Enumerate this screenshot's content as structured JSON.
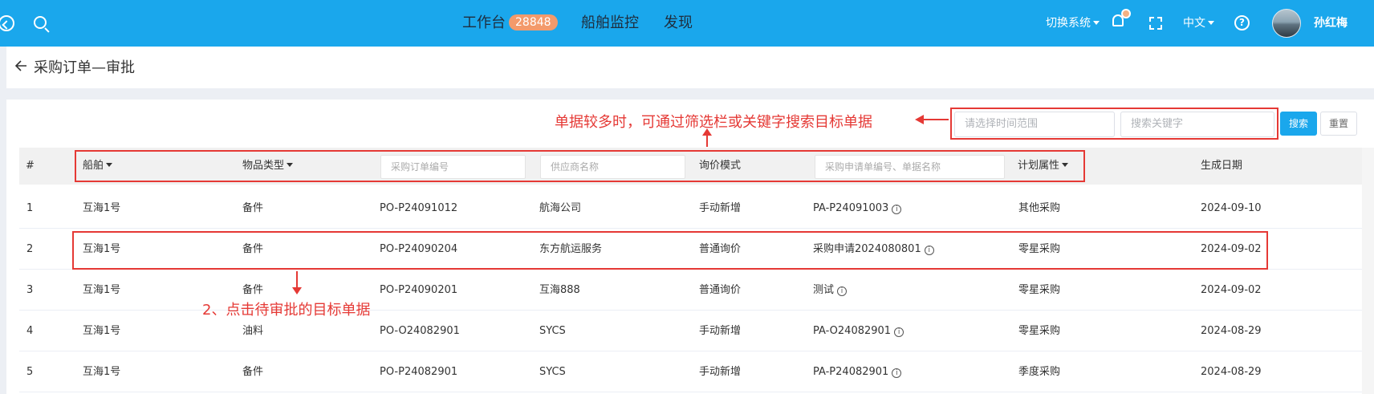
{
  "topbar": {
    "nav": [
      {
        "label": "工作台",
        "badge": "28848"
      },
      {
        "label": "船舶监控"
      },
      {
        "label": "发现"
      }
    ],
    "switch_system": "切换系统",
    "language": "中文",
    "user_name": "孙红梅",
    "colors": {
      "bar": "#1aa7ec",
      "badge": "#f39a6b"
    }
  },
  "page": {
    "title": "采购订单—审批"
  },
  "filters": {
    "time_range_placeholder": "请选择时间范围",
    "keyword_placeholder": "搜索关键字",
    "search_label": "搜索",
    "reset_label": "重置"
  },
  "table": {
    "headers": {
      "index": "#",
      "ship": "船舶",
      "item_type": "物品类型",
      "order_no_placeholder": "采购订单编号",
      "supplier_placeholder": "供应商名称",
      "inquiry_mode": "询价模式",
      "request_placeholder": "采购申请单编号、单据名称",
      "plan_attr": "计划属性",
      "created_date": "生成日期"
    },
    "rows": [
      {
        "index": "1",
        "ship": "互海1号",
        "item_type": "备件",
        "order_no": "PO-P24091012",
        "supplier": "航海公司",
        "inquiry_mode": "手动新增",
        "request": "PA-P24091003",
        "plan_attr": "其他采购",
        "created_date": "2024-09-10"
      },
      {
        "index": "2",
        "ship": "互海1号",
        "item_type": "备件",
        "order_no": "PO-P24090204",
        "supplier": "东方航运服务",
        "inquiry_mode": "普通询价",
        "request": "采购申请2024080801",
        "plan_attr": "零星采购",
        "created_date": "2024-09-02"
      },
      {
        "index": "3",
        "ship": "互海1号",
        "item_type": "备件",
        "order_no": "PO-P24090201",
        "supplier": "互海888",
        "inquiry_mode": "普通询价",
        "request": "测试",
        "plan_attr": "零星采购",
        "created_date": "2024-09-02"
      },
      {
        "index": "4",
        "ship": "互海1号",
        "item_type": "油料",
        "order_no": "PO-O24082901",
        "supplier": "SYCS",
        "inquiry_mode": "手动新增",
        "request": "PA-O24082901",
        "plan_attr": "零星采购",
        "created_date": "2024-08-29"
      },
      {
        "index": "5",
        "ship": "互海1号",
        "item_type": "备件",
        "order_no": "PO-P24082901",
        "supplier": "SYCS",
        "inquiry_mode": "手动新增",
        "request": "PA-P24082901",
        "plan_attr": "季度采购",
        "created_date": "2024-08-29"
      }
    ]
  },
  "annotations": {
    "filter_hint": "单据较多时，可通过筛选栏或关键字搜索目标单据",
    "click_hint": "2、点击待审批的目标单据",
    "color": "#e53935"
  },
  "icons": [
    "back-circle-icon",
    "search-icon",
    "bell-icon",
    "fullscreen-icon",
    "help-icon",
    "info-icon",
    "caret-down-icon"
  ]
}
